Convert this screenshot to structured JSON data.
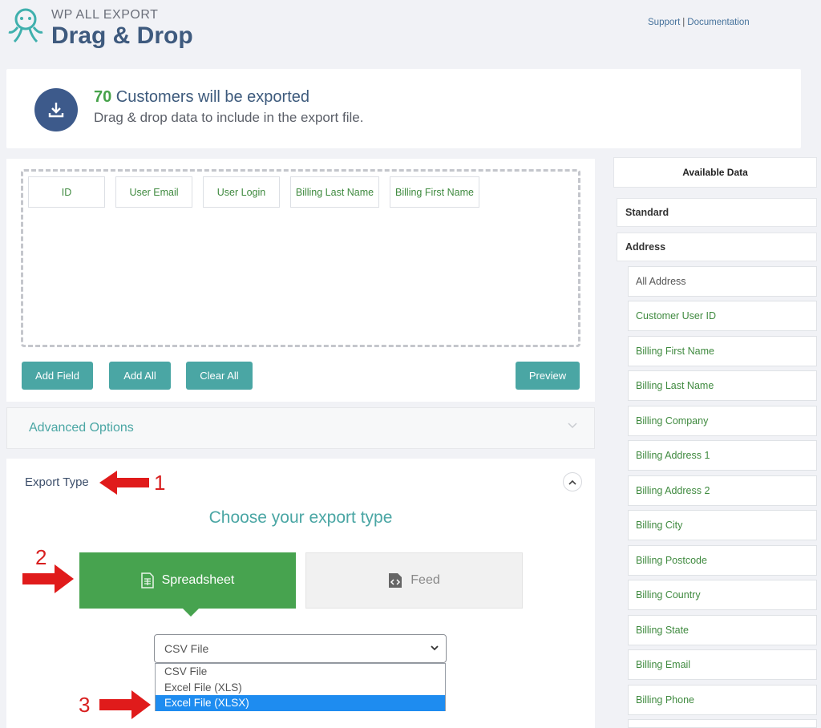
{
  "header": {
    "brand_sub": "WP ALL EXPORT",
    "brand_main": "Drag & Drop",
    "support_label": "Support",
    "separator": "|",
    "documentation_label": "Documentation"
  },
  "banner": {
    "count": "70",
    "title_rest": " Customers will be exported",
    "subtitle": "Drag & drop data to include in the export file."
  },
  "fields_selected": [
    "ID",
    "User Email",
    "User Login",
    "Billing Last Name",
    "Billing First Name"
  ],
  "buttons": {
    "add_field": "Add Field",
    "add_all": "Add All",
    "clear_all": "Clear All",
    "preview": "Preview"
  },
  "advanced_options_label": "Advanced Options",
  "export_type": {
    "label": "Export Type",
    "choose_title": "Choose your export type",
    "spreadsheet_label": "Spreadsheet",
    "feed_label": "Feed",
    "selected_value": "CSV File",
    "options": [
      "CSV File",
      "Excel File (XLS)",
      "Excel File (XLSX)"
    ],
    "highlighted_option": "Excel File (XLSX)"
  },
  "annotations": [
    "1",
    "2",
    "3"
  ],
  "available_data": {
    "title": "Available Data",
    "standard_label": "Standard",
    "address_label": "Address",
    "fields": [
      "All Address",
      "Customer User ID",
      "Billing First Name",
      "Billing Last Name",
      "Billing Company",
      "Billing Address 1",
      "Billing Address 2",
      "Billing City",
      "Billing Postcode",
      "Billing Country",
      "Billing State",
      "Billing Email",
      "Billing Phone"
    ]
  },
  "colors": {
    "accent_teal": "#4aa6a4",
    "spreadsheet_green": "#47a34f",
    "annotation_red": "#d81f1f",
    "brand_blue": "#3e5a7e"
  }
}
